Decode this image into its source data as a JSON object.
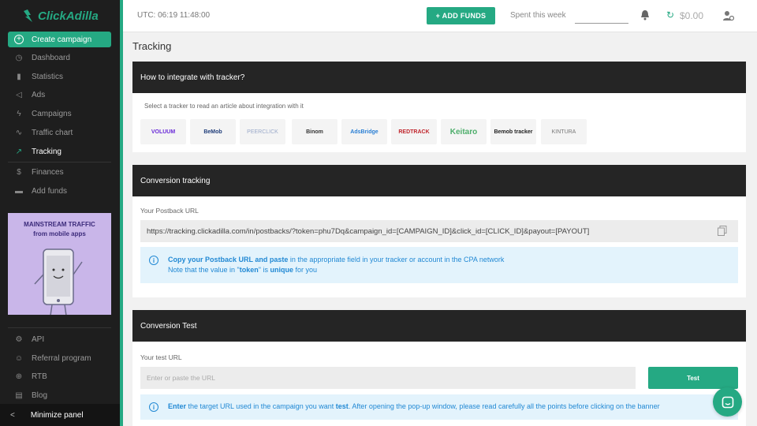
{
  "app": {
    "logo_text": "ClickAdilla"
  },
  "sidebar": {
    "create_label": "Create campaign",
    "items": [
      {
        "label": "Dashboard",
        "icon": "clock-icon"
      },
      {
        "label": "Statistics",
        "icon": "bar-chart-icon"
      },
      {
        "label": "Ads",
        "icon": "megaphone-icon"
      },
      {
        "label": "Campaigns",
        "icon": "lightning-icon"
      },
      {
        "label": "Traffic chart",
        "icon": "chart-icon"
      },
      {
        "label": "Tracking",
        "icon": "trend-icon"
      },
      {
        "label": "Finances",
        "icon": "dollar-icon"
      },
      {
        "label": "Add funds",
        "icon": "card-icon"
      }
    ],
    "banner": {
      "line1": "MAINSTREAM TRAFFIC",
      "line2": "from mobile apps"
    },
    "bottom_items": [
      {
        "label": "API",
        "icon": "api-icon"
      },
      {
        "label": "Referral program",
        "icon": "referral-icon"
      },
      {
        "label": "RTB",
        "icon": "rtb-icon"
      },
      {
        "label": "Blog",
        "icon": "blog-icon"
      }
    ],
    "minimize_label": "Minimize panel"
  },
  "topbar": {
    "utc": "UTC: 06:19 11:48:00",
    "add_funds": "+ ADD FUNDS",
    "spent_label": "Spent this week",
    "balance": "$0.00"
  },
  "page": {
    "title": "Tracking"
  },
  "integration": {
    "heading": "How to integrate with tracker?",
    "hint": "Select a tracker to read an article about integration with it",
    "trackers": [
      "VOLUUM",
      "BeMob",
      "PEERCLICK",
      "Binom",
      "AdsBridge",
      "REDTRACK",
      "Keitaro",
      "Bemob tracker",
      "KINTURA"
    ]
  },
  "conversion": {
    "heading": "Conversion tracking",
    "postback_label": "Your Postback URL",
    "postback_url": "https://tracking.clickadilla.com/in/postbacks/?token=phu7Dq&campaign_id=[CAMPAIGN_ID]&click_id=[CLICK_ID]&payout=[PAYOUT]",
    "info_bold": "Copy your Postback URL and paste",
    "info_rest": " in the appropriate field in your tracker or account in the CPA network",
    "info_line2_a": "Note that the value in \"",
    "info_line2_token": "token",
    "info_line2_b": "\" is ",
    "info_line2_unique": "unique",
    "info_line2_c": " for you"
  },
  "test": {
    "heading": "Conversion Test",
    "url_label": "Your test URL",
    "placeholder": "Enter or paste the URL",
    "button": "Test",
    "info_bold": "Enter",
    "info_mid": " the target URL used in the campaign you want ",
    "info_bold2": "test",
    "info_rest": ". After opening the pop-up window, please read carefully all the points before clicking on the banner"
  },
  "colors": {
    "accent": "#25a983",
    "dark": "#252525",
    "info_bg": "#e3f3fc",
    "info_text": "#2289d4"
  }
}
